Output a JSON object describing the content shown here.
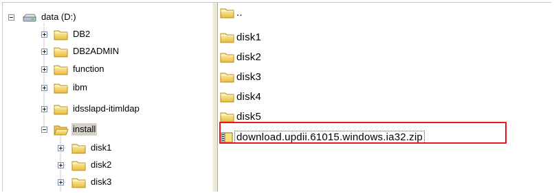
{
  "tree": {
    "root": {
      "label": "data (D:)",
      "icon": "drive-icon",
      "expanded": true
    },
    "items": [
      {
        "label": "DB2",
        "icon": "folder-icon",
        "expanded": false
      },
      {
        "label": "DB2ADMIN",
        "icon": "folder-icon",
        "expanded": false
      },
      {
        "label": "function",
        "icon": "folder-icon",
        "expanded": false
      },
      {
        "label": "ibm",
        "icon": "folder-icon",
        "expanded": false
      },
      {
        "label": "idsslapd-itimldap",
        "icon": "folder-icon",
        "expanded": false
      },
      {
        "label": "install",
        "icon": "folder-open-icon",
        "expanded": true,
        "selected": true
      },
      {
        "label": "disk1",
        "icon": "folder-icon",
        "expanded": false
      },
      {
        "label": "disk2",
        "icon": "folder-icon",
        "expanded": false
      },
      {
        "label": "disk3",
        "icon": "folder-icon",
        "expanded": false
      }
    ]
  },
  "files": {
    "items": [
      {
        "label": "..",
        "icon": "folder-up-icon"
      },
      {
        "label": "disk1",
        "icon": "folder-icon"
      },
      {
        "label": "disk2",
        "icon": "folder-icon"
      },
      {
        "label": "disk3",
        "icon": "folder-icon"
      },
      {
        "label": "disk4",
        "icon": "folder-icon"
      },
      {
        "label": "disk5",
        "icon": "folder-icon"
      },
      {
        "label": "download.updii.61015.windows.ia32.zip",
        "icon": "zip-file-icon",
        "highlighted": true
      }
    ]
  },
  "colors": {
    "highlight_border": "#e8151a",
    "selection": "#d4d0c8",
    "folder": "#f5d25c"
  }
}
